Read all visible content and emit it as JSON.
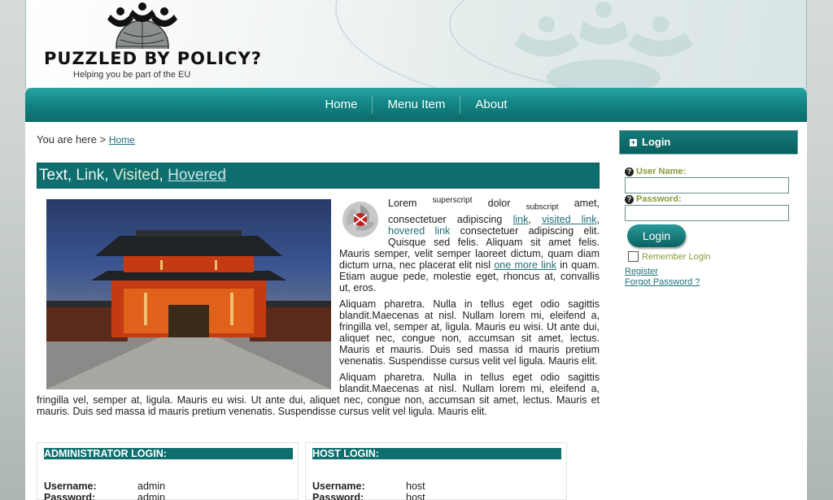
{
  "header": {
    "logo_title": "PUZZLED BY POLICY?",
    "logo_tagline": "Helping you be part of the EU"
  },
  "nav": {
    "items": [
      {
        "label": "Home"
      },
      {
        "label": "Menu Item"
      },
      {
        "label": "About"
      }
    ]
  },
  "breadcrumb": {
    "prefix": "You are here >",
    "link": "Home"
  },
  "title_bar": {
    "text": "Text",
    "link": "Link",
    "visited": "Visited",
    "hovered": "Hovered",
    "sep": ","
  },
  "article": {
    "p1_lorem": "Lorem",
    "p1_sup": "superscript",
    "p1_dolor": "dolor",
    "p1_sub": "subscript",
    "p1_a": "amet, consectetuer adipiscing",
    "p1_link": "link",
    "p1_visited": "visited link",
    "p1_hovered": "hovered link",
    "p1_b": "consectetuer adipiscing elit. Quisque sed felis. Aliquam sit amet felis. Mauris semper, velit semper laoreet dictum, quam diam dictum urna, nec placerat elit nisl",
    "p1_more": "one more link",
    "p1_c": "in quam. Etiam augue pede, molestie eget, rhoncus at, convallis ut, eros.",
    "p2": "Aliquam pharetra. Nulla in tellus eget odio sagittis blandit.Maecenas at nisl. Nullam lorem mi, eleifend a, fringilla vel, semper at, ligula. Mauris eu wisi. Ut ante dui, aliquet nec, congue non, accumsan sit amet, lectus. Mauris et mauris. Duis sed massa id mauris pretium venenatis. Suspendisse cursus velit vel ligula. Mauris elit.",
    "p3": "Aliquam pharetra. Nulla in tellus eget odio sagittis blandit.Maecenas at nisl. Nullam lorem mi, eleifend a, fringilla vel, semper at, ligula. Mauris eu wisi. Ut ante dui, aliquet nec, congue non, accumsan sit amet, lectus. Mauris et mauris. Duis sed massa id mauris pretium venenatis. Suspendisse cursus velit vel ligula. Mauris elit."
  },
  "admin_box": {
    "heading": "ADMINISTRATOR LOGIN:",
    "username_label": "Username:",
    "username": "admin",
    "password_label": "Password:",
    "password": "admin"
  },
  "host_box": {
    "heading": "HOST LOGIN:",
    "username_label": "Username:",
    "username": "host",
    "password_label": "Password:",
    "password": "host"
  },
  "sidebar": {
    "heading": "Login",
    "username_label": "User Name:",
    "password_label": "Password:",
    "login_button": "Login",
    "remember_label": "Remember Login",
    "register_link": "Register",
    "forgot_link": "Forgot Password ?"
  },
  "colors": {
    "accent": "#0f6e6e",
    "link": "#1f6f79",
    "label": "#8a9a3a"
  }
}
